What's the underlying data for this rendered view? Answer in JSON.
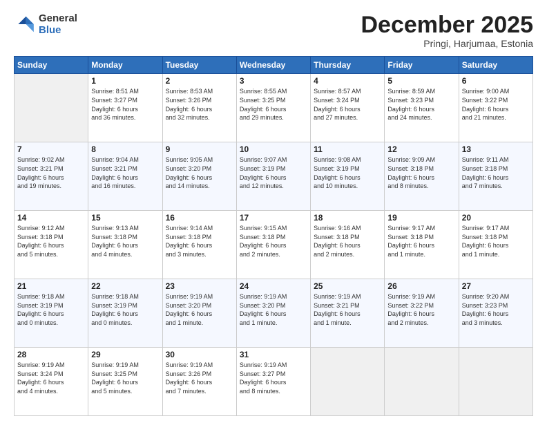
{
  "logo": {
    "general": "General",
    "blue": "Blue"
  },
  "header": {
    "month": "December 2025",
    "location": "Pringi, Harjumaa, Estonia"
  },
  "weekdays": [
    "Sunday",
    "Monday",
    "Tuesday",
    "Wednesday",
    "Thursday",
    "Friday",
    "Saturday"
  ],
  "weeks": [
    [
      {
        "day": "",
        "info": ""
      },
      {
        "day": "1",
        "info": "Sunrise: 8:51 AM\nSunset: 3:27 PM\nDaylight: 6 hours\nand 36 minutes."
      },
      {
        "day": "2",
        "info": "Sunrise: 8:53 AM\nSunset: 3:26 PM\nDaylight: 6 hours\nand 32 minutes."
      },
      {
        "day": "3",
        "info": "Sunrise: 8:55 AM\nSunset: 3:25 PM\nDaylight: 6 hours\nand 29 minutes."
      },
      {
        "day": "4",
        "info": "Sunrise: 8:57 AM\nSunset: 3:24 PM\nDaylight: 6 hours\nand 27 minutes."
      },
      {
        "day": "5",
        "info": "Sunrise: 8:59 AM\nSunset: 3:23 PM\nDaylight: 6 hours\nand 24 minutes."
      },
      {
        "day": "6",
        "info": "Sunrise: 9:00 AM\nSunset: 3:22 PM\nDaylight: 6 hours\nand 21 minutes."
      }
    ],
    [
      {
        "day": "7",
        "info": "Sunrise: 9:02 AM\nSunset: 3:21 PM\nDaylight: 6 hours\nand 19 minutes."
      },
      {
        "day": "8",
        "info": "Sunrise: 9:04 AM\nSunset: 3:21 PM\nDaylight: 6 hours\nand 16 minutes."
      },
      {
        "day": "9",
        "info": "Sunrise: 9:05 AM\nSunset: 3:20 PM\nDaylight: 6 hours\nand 14 minutes."
      },
      {
        "day": "10",
        "info": "Sunrise: 9:07 AM\nSunset: 3:19 PM\nDaylight: 6 hours\nand 12 minutes."
      },
      {
        "day": "11",
        "info": "Sunrise: 9:08 AM\nSunset: 3:19 PM\nDaylight: 6 hours\nand 10 minutes."
      },
      {
        "day": "12",
        "info": "Sunrise: 9:09 AM\nSunset: 3:18 PM\nDaylight: 6 hours\nand 8 minutes."
      },
      {
        "day": "13",
        "info": "Sunrise: 9:11 AM\nSunset: 3:18 PM\nDaylight: 6 hours\nand 7 minutes."
      }
    ],
    [
      {
        "day": "14",
        "info": "Sunrise: 9:12 AM\nSunset: 3:18 PM\nDaylight: 6 hours\nand 5 minutes."
      },
      {
        "day": "15",
        "info": "Sunrise: 9:13 AM\nSunset: 3:18 PM\nDaylight: 6 hours\nand 4 minutes."
      },
      {
        "day": "16",
        "info": "Sunrise: 9:14 AM\nSunset: 3:18 PM\nDaylight: 6 hours\nand 3 minutes."
      },
      {
        "day": "17",
        "info": "Sunrise: 9:15 AM\nSunset: 3:18 PM\nDaylight: 6 hours\nand 2 minutes."
      },
      {
        "day": "18",
        "info": "Sunrise: 9:16 AM\nSunset: 3:18 PM\nDaylight: 6 hours\nand 2 minutes."
      },
      {
        "day": "19",
        "info": "Sunrise: 9:17 AM\nSunset: 3:18 PM\nDaylight: 6 hours\nand 1 minute."
      },
      {
        "day": "20",
        "info": "Sunrise: 9:17 AM\nSunset: 3:18 PM\nDaylight: 6 hours\nand 1 minute."
      }
    ],
    [
      {
        "day": "21",
        "info": "Sunrise: 9:18 AM\nSunset: 3:19 PM\nDaylight: 6 hours\nand 0 minutes."
      },
      {
        "day": "22",
        "info": "Sunrise: 9:18 AM\nSunset: 3:19 PM\nDaylight: 6 hours\nand 0 minutes."
      },
      {
        "day": "23",
        "info": "Sunrise: 9:19 AM\nSunset: 3:20 PM\nDaylight: 6 hours\nand 1 minute."
      },
      {
        "day": "24",
        "info": "Sunrise: 9:19 AM\nSunset: 3:20 PM\nDaylight: 6 hours\nand 1 minute."
      },
      {
        "day": "25",
        "info": "Sunrise: 9:19 AM\nSunset: 3:21 PM\nDaylight: 6 hours\nand 1 minute."
      },
      {
        "day": "26",
        "info": "Sunrise: 9:19 AM\nSunset: 3:22 PM\nDaylight: 6 hours\nand 2 minutes."
      },
      {
        "day": "27",
        "info": "Sunrise: 9:20 AM\nSunset: 3:23 PM\nDaylight: 6 hours\nand 3 minutes."
      }
    ],
    [
      {
        "day": "28",
        "info": "Sunrise: 9:19 AM\nSunset: 3:24 PM\nDaylight: 6 hours\nand 4 minutes."
      },
      {
        "day": "29",
        "info": "Sunrise: 9:19 AM\nSunset: 3:25 PM\nDaylight: 6 hours\nand 5 minutes."
      },
      {
        "day": "30",
        "info": "Sunrise: 9:19 AM\nSunset: 3:26 PM\nDaylight: 6 hours\nand 7 minutes."
      },
      {
        "day": "31",
        "info": "Sunrise: 9:19 AM\nSunset: 3:27 PM\nDaylight: 6 hours\nand 8 minutes."
      },
      {
        "day": "",
        "info": ""
      },
      {
        "day": "",
        "info": ""
      },
      {
        "day": "",
        "info": ""
      }
    ]
  ]
}
